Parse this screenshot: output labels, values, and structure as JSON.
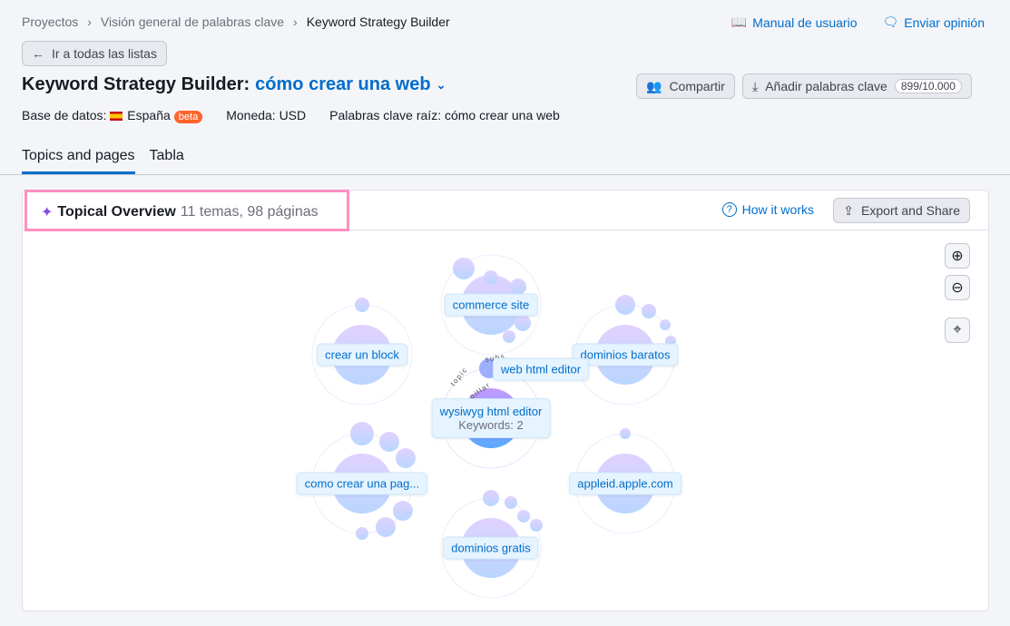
{
  "breadcrumb": [
    "Proyectos",
    "Visión general de palabras clave",
    "Keyword Strategy Builder"
  ],
  "links": {
    "manual": "Manual de usuario",
    "feedback": "Enviar opinión"
  },
  "back_button": "Ir a todas las listas",
  "title": {
    "prefix": "Keyword Strategy Builder:",
    "keyword": "cómo crear una web"
  },
  "actions": {
    "share": "Compartir",
    "add": "Añadir palabras clave",
    "count": "899/10.000"
  },
  "meta": {
    "db_label": "Base de datos:",
    "db_value": "España",
    "beta": "beta",
    "currency": "Moneda: USD",
    "root": "Palabras clave raíz: cómo crear una web"
  },
  "tabs": [
    {
      "label": "Topics and pages",
      "active": true
    },
    {
      "label": "Tabla",
      "active": false
    }
  ],
  "overview": {
    "title": "Topical Overview",
    "subtitle": "11 temas, 98 páginas",
    "how": "How it works",
    "export": "Export and Share"
  },
  "graph": {
    "center": {
      "label": "wysiwyg html editor",
      "keywords": "Keywords: 2",
      "ring_labels": [
        "topic",
        "pillar",
        "subs"
      ]
    },
    "subtopic": "web html editor",
    "topics": [
      "commerce site",
      "crear un block",
      "dominios baratos",
      "como crear una pag...",
      "appleid.apple.com",
      "dominios gratis"
    ]
  },
  "colors": {
    "accent": "#006dca",
    "highlight": "#ff8fc0",
    "beta": "#ff642d"
  }
}
